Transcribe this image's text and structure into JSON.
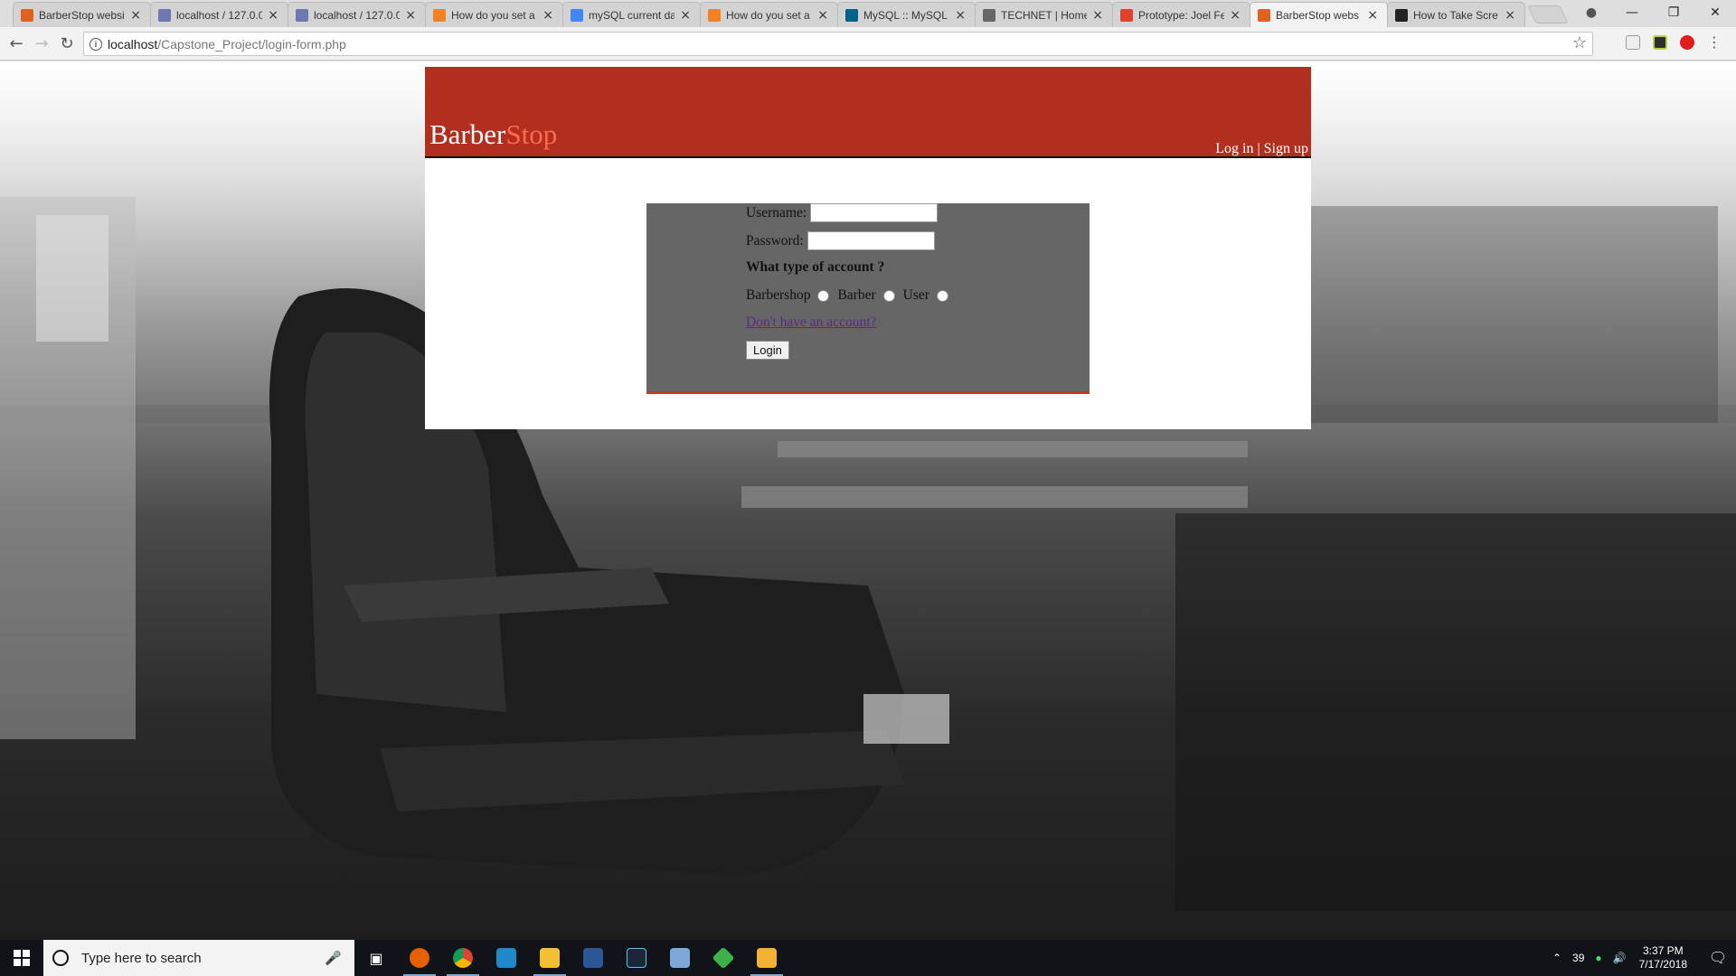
{
  "browser": {
    "tabs": [
      {
        "title": "BarberStop website",
        "favicon_color": "#e0621f",
        "active": false
      },
      {
        "title": "localhost / 127.0.0.1",
        "favicon_color": "#6c78af",
        "active": false
      },
      {
        "title": "localhost / 127.0.0.1",
        "favicon_color": "#6c78af",
        "active": false
      },
      {
        "title": "How do you set a",
        "favicon_color": "#f48024",
        "active": false
      },
      {
        "title": "mySQL current da",
        "favicon_color": "#4285f4",
        "active": false
      },
      {
        "title": "How do you set a",
        "favicon_color": "#f48024",
        "active": false
      },
      {
        "title": "MySQL :: MySQL",
        "favicon_color": "#00618a",
        "active": false
      },
      {
        "title": "TECHNET | Home",
        "favicon_color": "#666666",
        "active": false
      },
      {
        "title": "Prototype: Joel Fe",
        "favicon_color": "#e2412e",
        "active": false
      },
      {
        "title": "BarberStop webs",
        "favicon_color": "#e0621f",
        "active": true
      },
      {
        "title": "How to Take Scre",
        "favicon_color": "#222222",
        "active": false
      }
    ],
    "url_host": "localhost",
    "url_path": "/Capstone_Project/login-form.php"
  },
  "site": {
    "logo_part1": "Barber",
    "logo_part2": "Stop",
    "login_link": "Log in",
    "separator": "|",
    "signup_link": "Sign up",
    "colors": {
      "header": "#b22f1f",
      "accent": "#ff6a4f",
      "form_bg": "#666666"
    }
  },
  "form": {
    "username_label": "Username:",
    "username_value": "",
    "password_label": "Password:",
    "password_value": "",
    "account_question": "What type of account ?",
    "account_options": [
      "Barbershop",
      "Barber",
      "User"
    ],
    "signup_prompt": "Don't have an account?",
    "login_button": "Login"
  },
  "taskbar": {
    "search_placeholder": "Type here to search",
    "temperature": "39",
    "time": "3:37 PM",
    "date": "7/17/2018"
  }
}
